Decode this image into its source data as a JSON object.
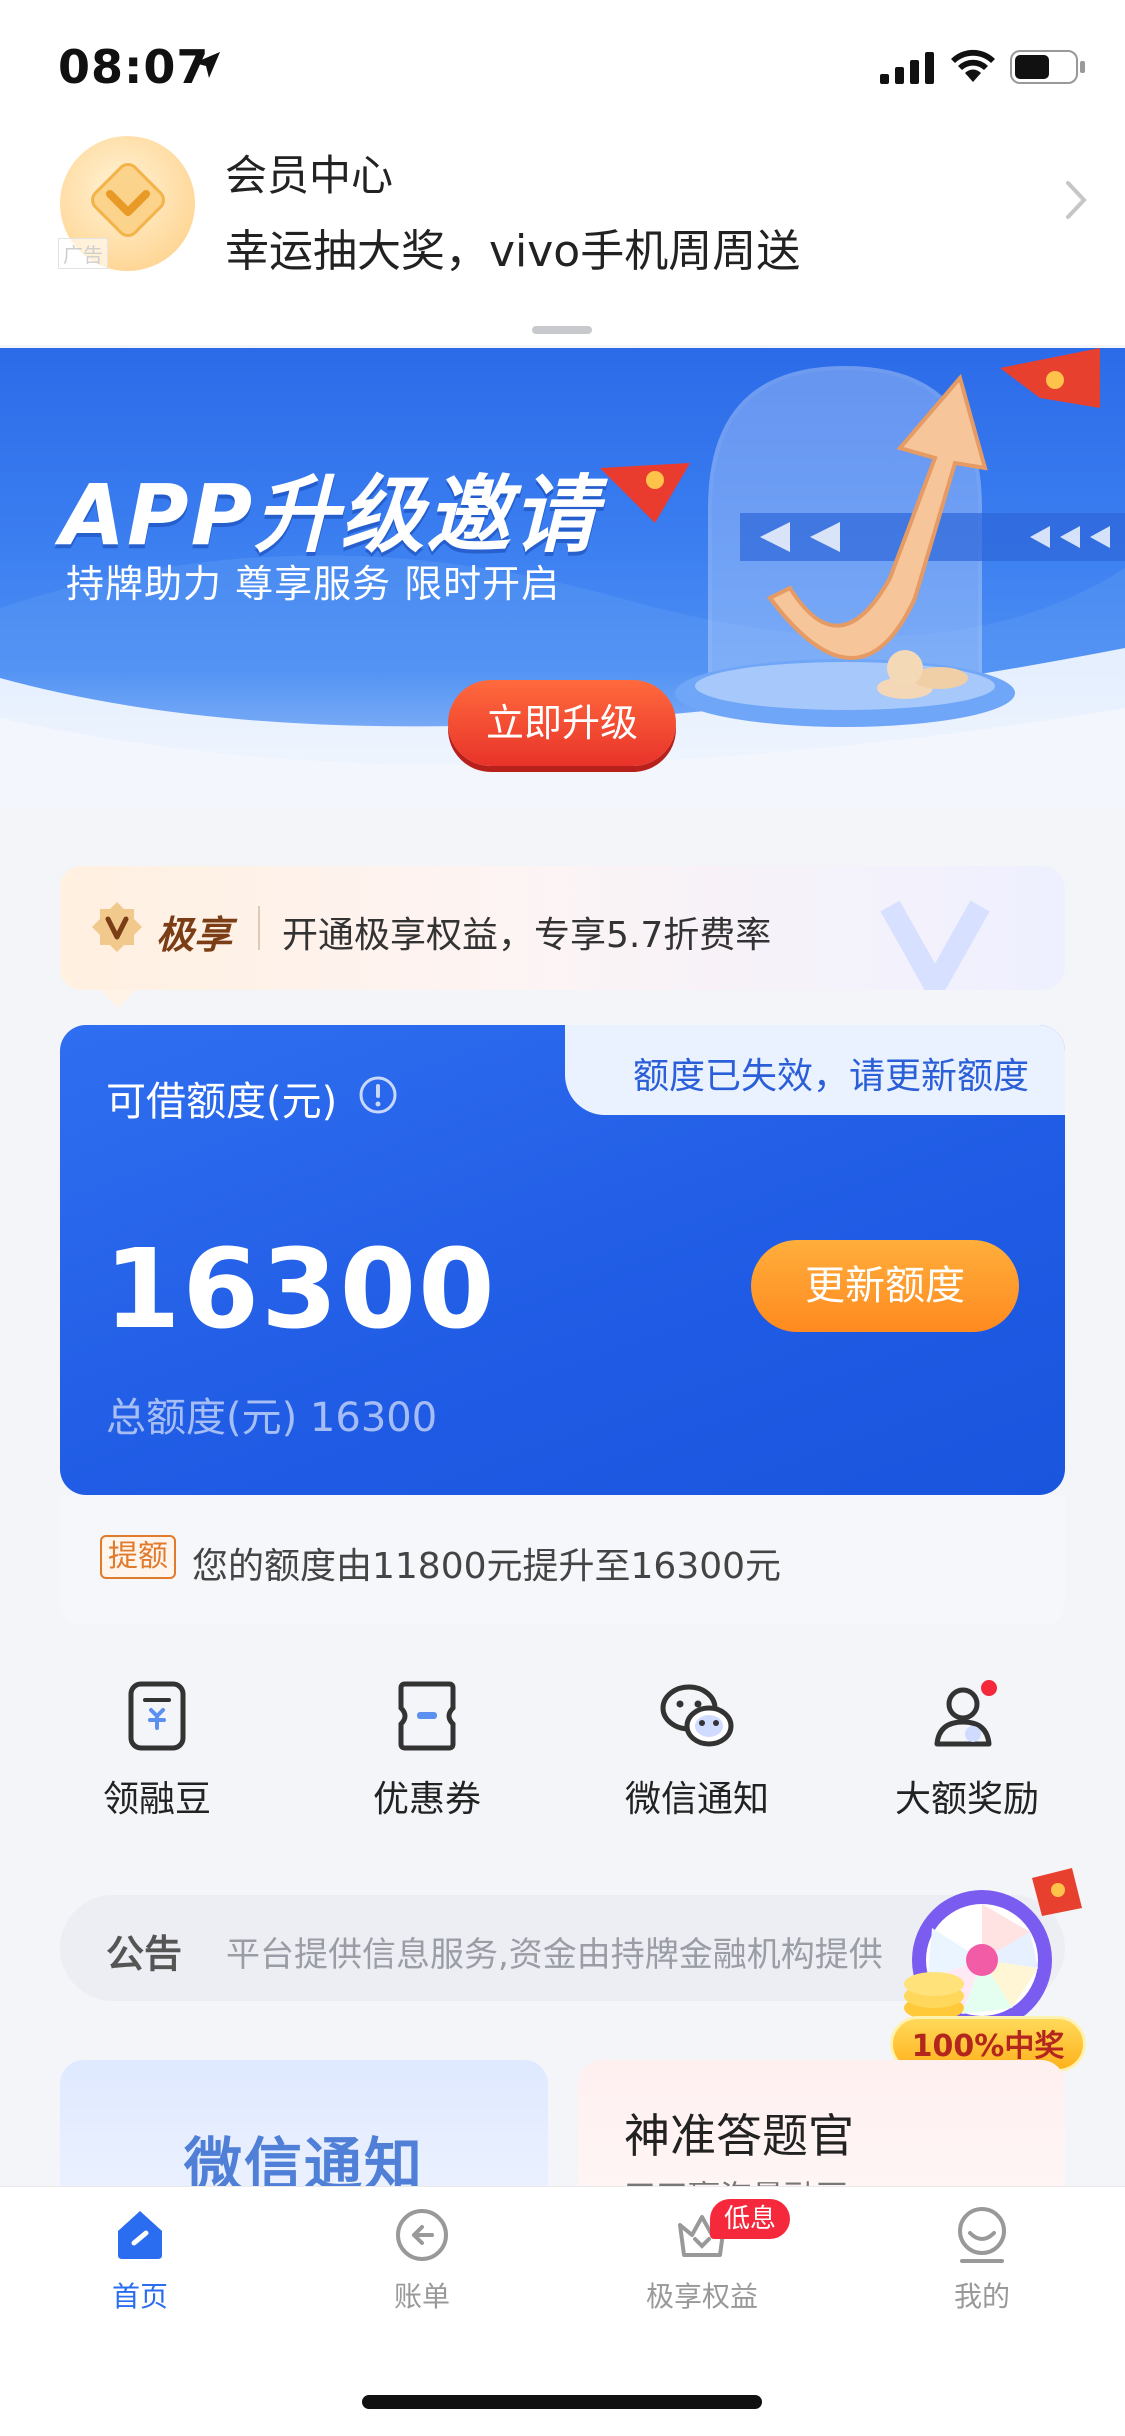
{
  "status_bar": {
    "time": "08:07"
  },
  "member": {
    "ad_tag": "广告",
    "title": "会员中心",
    "subtitle": "幸运抽大奖，vivo手机周周送"
  },
  "promo": {
    "title": "APP升级邀请",
    "subtitle": "持牌助力 尊享服务 限时开启",
    "button": "立即升级"
  },
  "vip": {
    "brand": "极享",
    "text": "开通极享权益，专享5.7折费率"
  },
  "credit": {
    "label": "可借额度(元)",
    "notice": "额度已失效，请更新额度",
    "amount": "16300",
    "total": "总额度(元) 16300",
    "button": "更新额度",
    "raise_tag": "提额",
    "raise_text": "您的额度由11800元提升至16300元"
  },
  "shortcuts": [
    {
      "label": "领融豆",
      "icon": "bean-card-icon"
    },
    {
      "label": "优惠券",
      "icon": "coupon-icon"
    },
    {
      "label": "微信通知",
      "icon": "wechat-icon"
    },
    {
      "label": "大额奖励",
      "icon": "user-reward-icon"
    }
  ],
  "announcement": {
    "tag": "公告",
    "text": "平台提供信息服务,资金由持牌金融机构提供"
  },
  "lottery": {
    "badge": "100%中奖"
  },
  "cards": {
    "left_title": "微信通知",
    "right_title": "神准答题官",
    "right_sub": "天天赢海量融豆"
  },
  "tabbar": {
    "items": [
      {
        "label": "首页",
        "icon": "home-icon",
        "active": true
      },
      {
        "label": "账单",
        "icon": "bill-icon",
        "active": false
      },
      {
        "label": "极享权益",
        "icon": "vip-crown-icon",
        "active": false,
        "badge": "低息"
      },
      {
        "label": "我的",
        "icon": "profile-icon",
        "active": false
      }
    ]
  },
  "colors": {
    "primary": "#2b6df0",
    "accent_orange": "#ff8a1f",
    "promo_red": "#e8332a"
  }
}
